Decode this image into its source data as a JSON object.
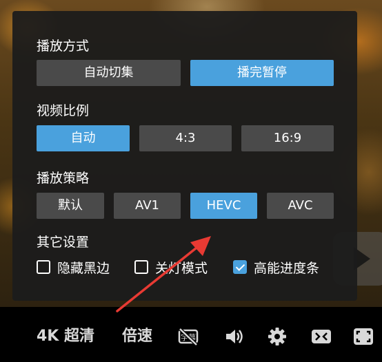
{
  "settings": {
    "play_mode": {
      "title": "播放方式",
      "options": [
        "自动切集",
        "播完暂停"
      ],
      "selected": "播完暂停"
    },
    "aspect_ratio": {
      "title": "视频比例",
      "options": [
        "自动",
        "4:3",
        "16:9"
      ],
      "selected": "自动"
    },
    "strategy": {
      "title": "播放策略",
      "options": [
        "默认",
        "AV1",
        "HEVC",
        "AVC"
      ],
      "selected": "HEVC"
    },
    "other": {
      "title": "其它设置",
      "checkboxes": [
        {
          "label": "隐藏黑边",
          "checked": false
        },
        {
          "label": "关灯模式",
          "checked": false
        },
        {
          "label": "高能进度条",
          "checked": true
        }
      ]
    }
  },
  "controls": {
    "quality": "4K 超清",
    "speed": "倍速",
    "icons": [
      "subtitle-off-icon",
      "volume-icon",
      "settings-gear-icon",
      "widescreen-icon",
      "fullscreen-icon"
    ]
  },
  "colors": {
    "accent": "#4aa1dd",
    "option_bg": "#4a4a4a",
    "annotation": "#e83a33"
  }
}
